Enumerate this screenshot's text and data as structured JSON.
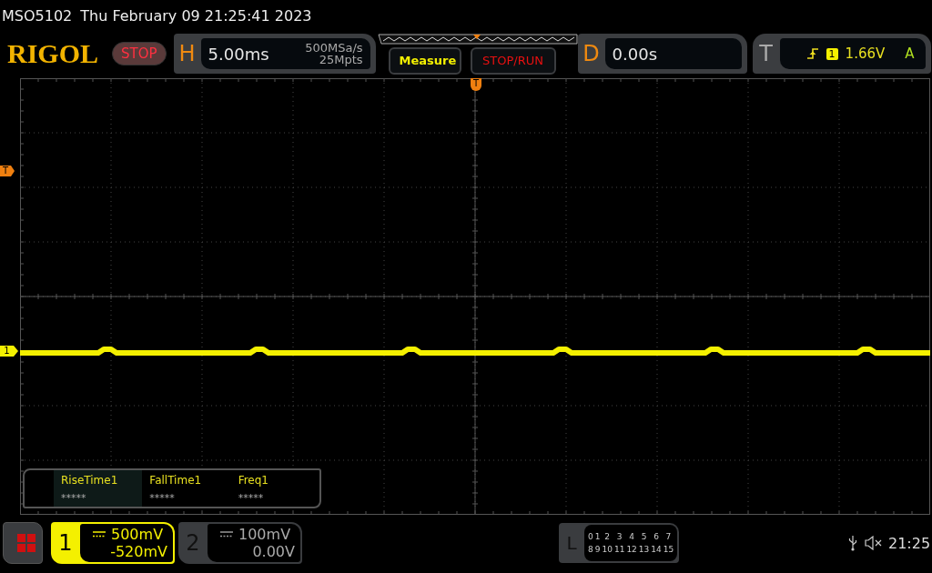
{
  "status_line": {
    "model": "MSO5102",
    "datetime": "Thu February 09 21:25:41 2023"
  },
  "header": {
    "logo": "RIGOL",
    "run_state": "STOP",
    "horizontal": {
      "label": "H",
      "timebase": "5.00ms",
      "sample_rate": "500MSa/s",
      "memory_depth": "25Mpts"
    },
    "buttons": [
      {
        "label": "Measure",
        "kind": "menu"
      },
      {
        "label": "STOP/RUN",
        "kind": "run"
      }
    ],
    "delay": {
      "label": "D",
      "value": "0.00s"
    },
    "trigger": {
      "label": "T",
      "source": "1",
      "level": "1.66V",
      "mode": "A"
    }
  },
  "markers": {
    "trigger_position": "T",
    "trigger_level": "T",
    "channel": "1"
  },
  "measurements": [
    {
      "name": "RiseTime1",
      "value": "*****"
    },
    {
      "name": "FallTime1",
      "value": "*****"
    },
    {
      "name": "Freq1",
      "value": "*****"
    }
  ],
  "channels": [
    {
      "number": "1",
      "scale": "500mV",
      "offset": "-520mV",
      "selected": true
    },
    {
      "number": "2",
      "scale": "100mV",
      "offset": "0.00V",
      "selected": false
    }
  ],
  "logic": {
    "label": "L",
    "rows": [
      [
        "0",
        "1",
        "2",
        "3",
        "4",
        "5",
        "6",
        "7"
      ],
      [
        "8",
        "9",
        "10",
        "11",
        "12",
        "13",
        "14",
        "15"
      ]
    ]
  },
  "status": {
    "time": "21:25"
  }
}
